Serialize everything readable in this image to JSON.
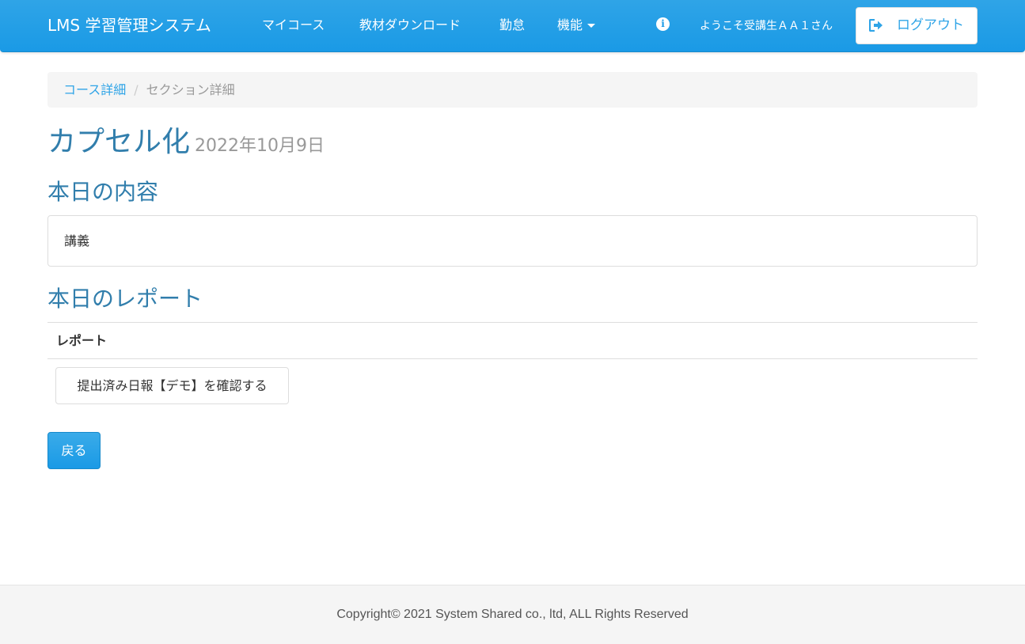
{
  "navbar": {
    "brand": "LMS 学習管理システム",
    "links": [
      "マイコース",
      "教材ダウンロード",
      "勤怠",
      "機能"
    ],
    "welcome": "ようこそ受講生ＡＡ１さん",
    "logout_label": "ログアウト",
    "info_icon": "info-circle-icon",
    "logout_icon": "sign-out-icon"
  },
  "breadcrumb": {
    "course_link": "コース詳細",
    "separator": "/",
    "current": "セクション詳細"
  },
  "page": {
    "title": "カプセル化",
    "date": "2022年10月9日"
  },
  "today_content": {
    "heading": "本日の内容",
    "text": "講義"
  },
  "today_report": {
    "heading": "本日のレポート",
    "column_header": "レポート",
    "button_label": "提出済み日報【デモ】を確認する"
  },
  "back_button_label": "戻る",
  "footer": {
    "copyright": "Copyright© 2021 System Shared co., ltd, ALL Rights Reserved"
  },
  "colors": {
    "navbar": "#2fa4e7",
    "heading": "#317eac",
    "link": "#2fa4e7",
    "muted": "#999999"
  }
}
